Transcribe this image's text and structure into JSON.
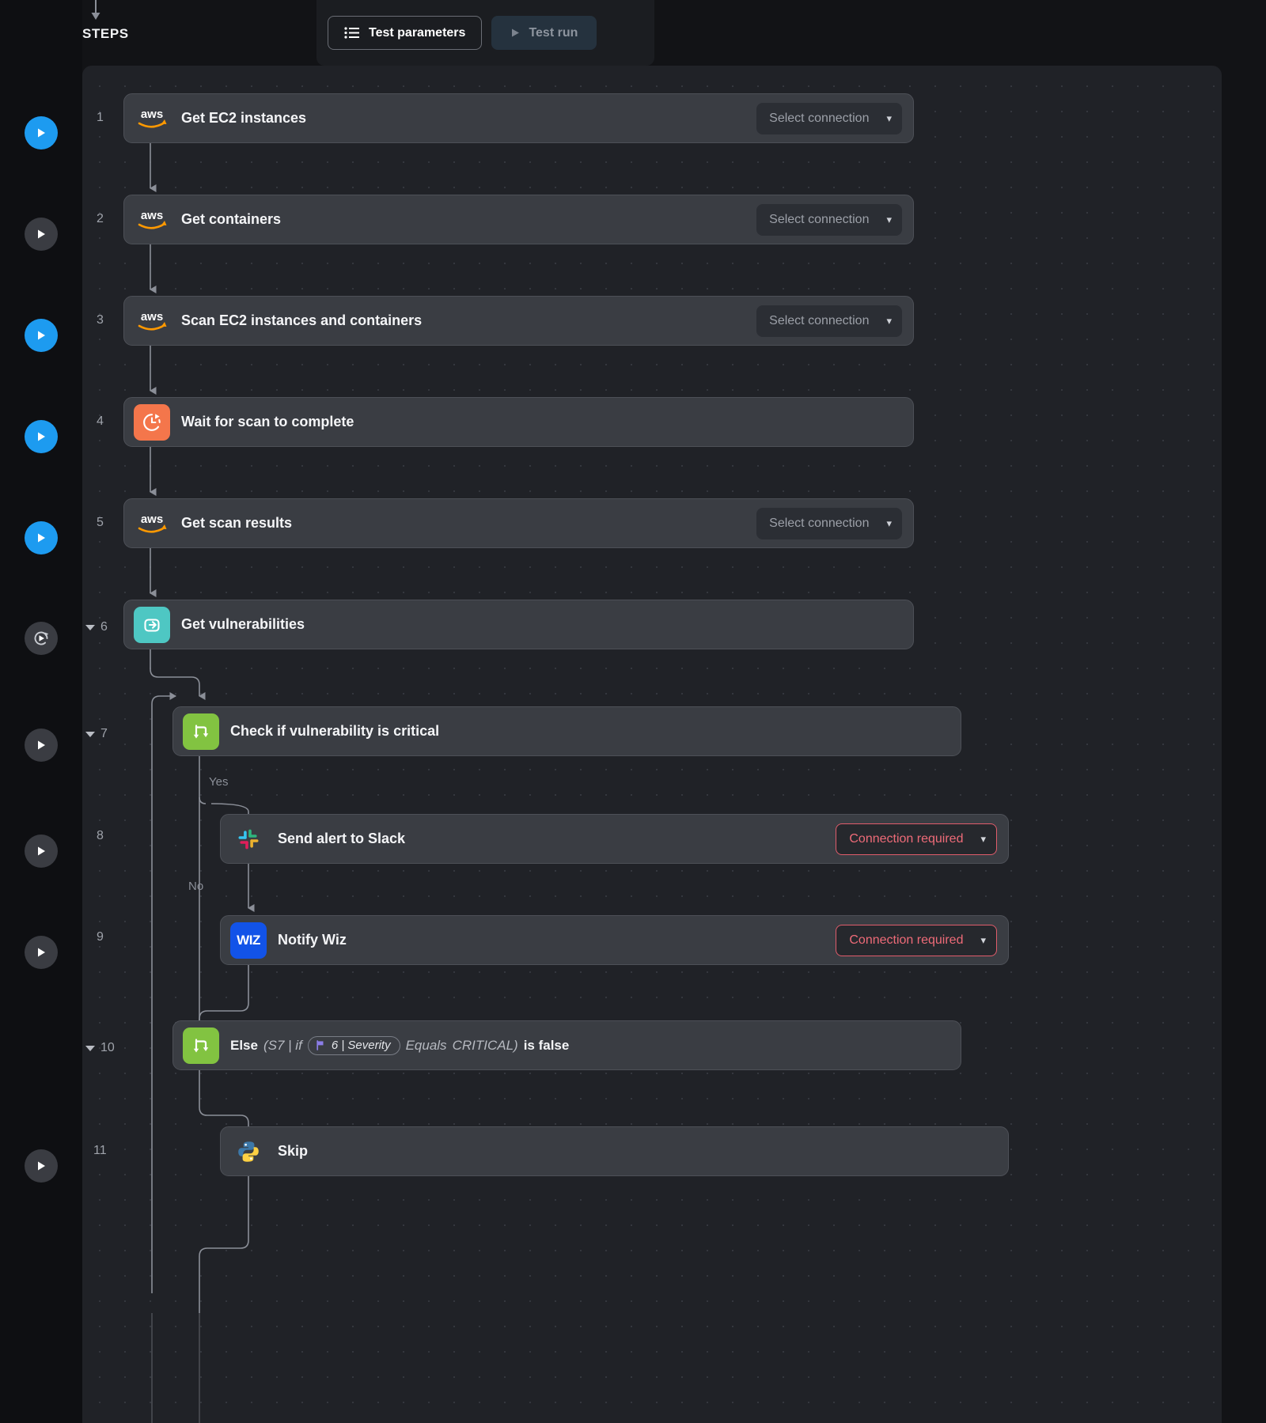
{
  "header": {
    "steps_label": "STEPS",
    "test_parameters_label": "Test parameters",
    "test_run_label": "Test run",
    "list_icon": "list-icon",
    "play_icon": "play-icon"
  },
  "connection_labels": {
    "select": "Select connection",
    "required": "Connection required",
    "chevron": "⌄"
  },
  "wires": {
    "yes_label": "Yes",
    "no_label": "No"
  },
  "steps": [
    {
      "number": "1",
      "title": "Get EC2 instances",
      "icon": "aws-icon",
      "connection": "Select connection",
      "connection_state": "empty",
      "run_state": "blue",
      "collapsible": false
    },
    {
      "number": "2",
      "title": "Get containers",
      "icon": "aws-icon",
      "connection": "Select connection",
      "connection_state": "empty",
      "run_state": "gray",
      "collapsible": false
    },
    {
      "number": "3",
      "title": "Scan EC2 instances and containers",
      "icon": "aws-icon",
      "connection": "Select connection",
      "connection_state": "empty",
      "run_state": "blue",
      "collapsible": false
    },
    {
      "number": "4",
      "title": "Wait for scan to complete",
      "icon": "timer-icon",
      "connection": null,
      "connection_state": "none",
      "run_state": "blue",
      "collapsible": false
    },
    {
      "number": "5",
      "title": "Get scan results",
      "icon": "aws-icon",
      "connection": "Select connection",
      "connection_state": "empty",
      "run_state": "blue",
      "collapsible": false
    },
    {
      "number": "6",
      "title": "Get vulnerabilities",
      "icon": "loop-icon",
      "connection": null,
      "connection_state": "none",
      "run_state": "loop",
      "collapsible": true
    },
    {
      "number": "7",
      "title": "Check if vulnerability is critical",
      "icon": "branch-icon",
      "connection": null,
      "connection_state": "none",
      "run_state": "gray",
      "collapsible": true
    },
    {
      "number": "8",
      "title": "Send alert to Slack",
      "icon": "slack-icon",
      "connection": "Connection required",
      "connection_state": "required",
      "run_state": "gray",
      "collapsible": false
    },
    {
      "number": "9",
      "title": "Notify Wiz",
      "icon": "wiz-icon",
      "icon_text": "WIZ",
      "connection": "Connection required",
      "connection_state": "required",
      "run_state": "gray",
      "collapsible": false
    },
    {
      "number": "10",
      "title": null,
      "icon": "branch-icon",
      "connection": null,
      "connection_state": "none",
      "run_state": "gray",
      "collapsible": true,
      "expression": {
        "lead": "Else",
        "open": "(S7 | if",
        "chip_icon": "flag-icon",
        "chip_text": "6 | Severity",
        "operator": "Equals",
        "value": "CRITICAL)",
        "tail": "is false"
      }
    },
    {
      "number": "11",
      "title": "Skip",
      "icon": "python-icon",
      "connection": null,
      "connection_state": "none",
      "run_state": "gray",
      "collapsible": false
    }
  ]
}
